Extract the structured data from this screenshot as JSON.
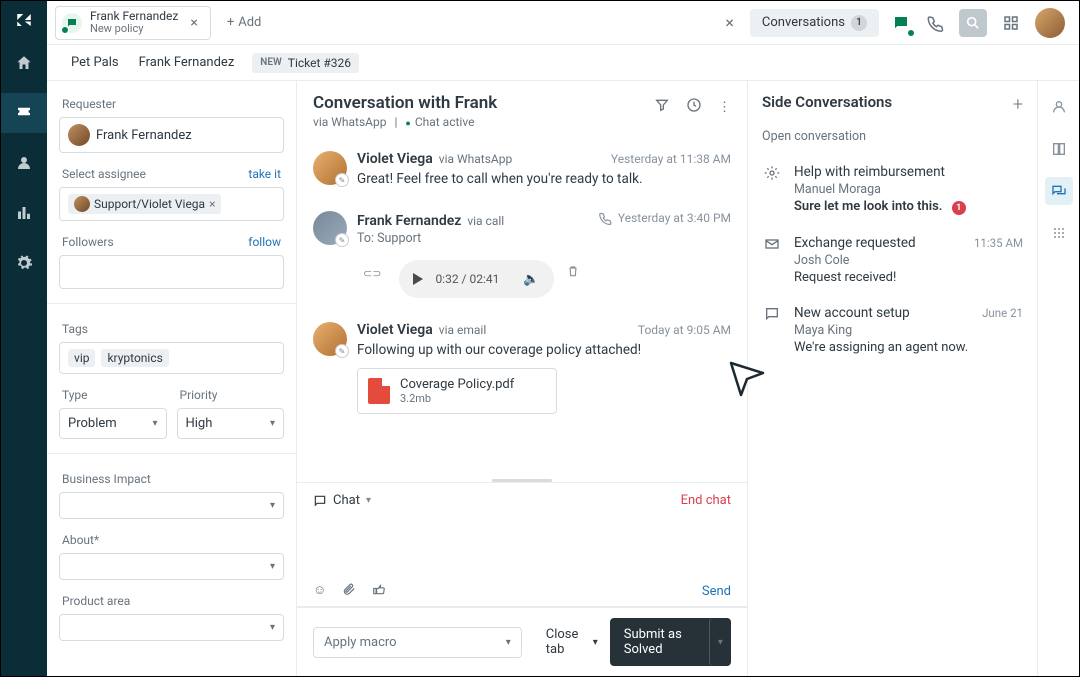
{
  "topbar": {
    "tab": {
      "name": "Frank Fernandez",
      "sub": "New policy"
    },
    "add": "Add",
    "conversations": "Conversations",
    "conv_count": "1"
  },
  "breadcrumb": {
    "root": "Pet Pals",
    "name": "Frank Fernandez",
    "new": "NEW",
    "ticket": "Ticket #326"
  },
  "left": {
    "requester_label": "Requester",
    "requester": "Frank Fernandez",
    "assignee_label": "Select assignee",
    "take_it": "take it",
    "assignee": "Support/Violet Viega",
    "followers_label": "Followers",
    "follow": "follow",
    "tags_label": "Tags",
    "tags": [
      "vip",
      "kryptonics"
    ],
    "type_label": "Type",
    "type": "Problem",
    "priority_label": "Priority",
    "priority": "High",
    "impact_label": "Business Impact",
    "about_label": "About*",
    "product_label": "Product area"
  },
  "conv": {
    "title": "Conversation with Frank",
    "via": "via WhatsApp",
    "status": "Chat active",
    "messages": [
      {
        "name": "Violet Viega",
        "via": "via WhatsApp",
        "time": "Yesterday at 11:38 AM",
        "text": "Great! Feel free to call when you're ready to talk."
      },
      {
        "name": "Frank Fernandez",
        "via": "via call",
        "time": "Yesterday at 3:40 PM",
        "to": "To: Support",
        "audio": "0:32 / 02:41"
      },
      {
        "name": "Violet Viega",
        "via": "via email",
        "time": "Today at 9:05 AM",
        "text": "Following up with our coverage policy attached!",
        "attach_name": "Coverage Policy.pdf",
        "attach_size": "3.2mb"
      }
    ],
    "chat_label": "Chat",
    "end_chat": "End chat",
    "send": "Send",
    "macro": "Apply macro",
    "close_tab": "Close tab",
    "submit": "Submit as Solved"
  },
  "side": {
    "title": "Side Conversations",
    "open": "Open conversation",
    "items": [
      {
        "title": "Help with reimbursement",
        "sub": "Manuel Moraga",
        "snip": "Sure let me look into this.",
        "badge": "1"
      },
      {
        "title": "Exchange requested",
        "sub": "Josh Cole",
        "snip": "Request received!",
        "time": "11:35 AM"
      },
      {
        "title": "New account setup",
        "sub": "Maya King",
        "snip": "We're assigning an agent now.",
        "time": "June 21"
      }
    ]
  }
}
